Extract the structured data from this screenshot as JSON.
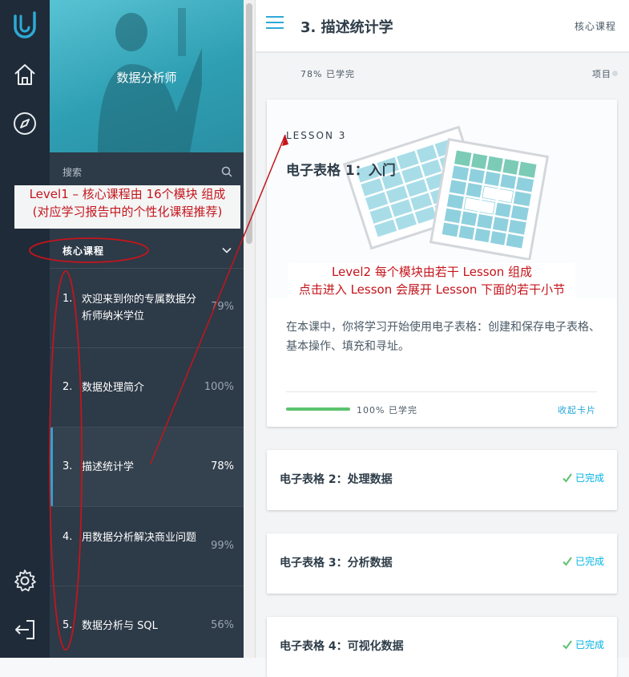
{
  "rail": {
    "logo_icon": "udacity-logo-icon",
    "home_icon": "home-icon",
    "compass_icon": "compass-icon",
    "settings_icon": "gear-icon",
    "logout_icon": "logout-icon"
  },
  "sidebar": {
    "hero_title": "数据分析师",
    "search_label": "搜索",
    "dropdown_label": "核心课程",
    "modules": [
      {
        "num": "1.",
        "name": "欢迎来到你的专属数据分析师纳米学位",
        "pct": "79%"
      },
      {
        "num": "2.",
        "name": "数据处理简介",
        "pct": "100%"
      },
      {
        "num": "3.",
        "name": "描述统计学",
        "pct": "78%"
      },
      {
        "num": "4.",
        "name": "用数据分析解决商业问题",
        "pct": "99%"
      },
      {
        "num": "5.",
        "name": "数据分析与 SQL",
        "pct": "56%"
      }
    ]
  },
  "header": {
    "title": "3. 描述统计学",
    "core_label": "核心课程"
  },
  "progress": {
    "label": "78% 已学完",
    "project_label": "项目"
  },
  "lesson_card": {
    "tag": "LESSON 3",
    "title": "电子表格 1：入门",
    "description": "在本课中，你将学习开始使用电子表格：创建和保存电子表格、基本操作、填充和寻址。",
    "progress_label": "100% 已学完",
    "progress_value": 1.0,
    "collapse_label": "收起卡片"
  },
  "lessons": [
    {
      "title": "电子表格 2：处理数据",
      "status": "已完成"
    },
    {
      "title": "电子表格 3：分析数据",
      "status": "已完成"
    },
    {
      "title": "电子表格 4：可视化数据",
      "status": "已完成"
    }
  ],
  "annotations": {
    "left_line1": "Level1 – 核心课程由 16个模块 组成",
    "left_line2": "(对应学习报告中的个性化课程推荐)",
    "right_line1": "Level2 每个模块由若干 Lesson 组成",
    "right_line2": "点击进入 Lesson 会展开 Lesson 下面的若干小节"
  },
  "colors": {
    "accent": "#02b3e4",
    "progress_green": "#5cc26e",
    "annotation_red": "#c4151c",
    "sidebar_bg": "#2d3a48",
    "rail_bg": "#1f2b38"
  }
}
